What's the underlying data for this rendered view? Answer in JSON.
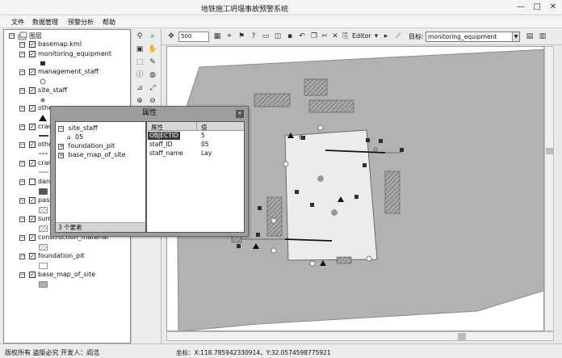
{
  "window": {
    "title": "地铁施工坍塌事故预警系统"
  },
  "titlebar_buttons": {
    "minimize": "—",
    "maximize": "□",
    "close": "✕"
  },
  "menu": [
    "文件",
    "数据管理",
    "预警分析",
    "帮助"
  ],
  "toc": {
    "root": "图层",
    "layers": [
      {
        "name": "basemap.kml",
        "checked": true
      },
      {
        "name": "monitoring_equipment",
        "checked": true
      },
      {
        "name": "management_staff",
        "checked": true
      },
      {
        "name": "site_staff",
        "checked": true
      },
      {
        "name": "othe",
        "checked": true
      },
      {
        "name": "crac",
        "checked": true
      },
      {
        "name": "othe",
        "checked": true
      },
      {
        "name": "cran",
        "checked": true
      },
      {
        "name": "dan",
        "checked": false
      },
      {
        "name": "pass",
        "checked": true
      },
      {
        "name": "surr",
        "checked": true
      },
      {
        "name": "construction_material",
        "checked": true
      },
      {
        "name": "foundation_pit",
        "checked": true
      },
      {
        "name": "base_map_of_site",
        "checked": true
      }
    ]
  },
  "toolbar": {
    "scale_value": "500",
    "editor_label": "Editor",
    "target_label": "目标:",
    "target_value": "monitoring_equipment"
  },
  "properties_window": {
    "title": "属性",
    "tree": [
      {
        "label": "site_staff",
        "expander": "−"
      },
      {
        "label": "05",
        "expander": ""
      },
      {
        "label": "foundation_pit",
        "expander": "+"
      },
      {
        "label": "base_map_of_site",
        "expander": "+"
      }
    ],
    "count": "3 个要素",
    "columns": {
      "attribute": "属性",
      "value": "值"
    },
    "rows": [
      {
        "attribute": "OBJECTID",
        "value": "5"
      },
      {
        "attribute": "staff_ID",
        "value": "05"
      },
      {
        "attribute": "staff_name",
        "value": "Lay"
      }
    ]
  },
  "status": {
    "left": "版权所有 盗版必究 开发人：阎浩",
    "coords": "坐标：X:118.785942330914，Y:32.0574598775921"
  },
  "colors": {
    "site_polygon": "#b2b2b2",
    "pit": "#ececec",
    "hatch": "#7a7a7a",
    "equipment": "#2e2e2e"
  }
}
